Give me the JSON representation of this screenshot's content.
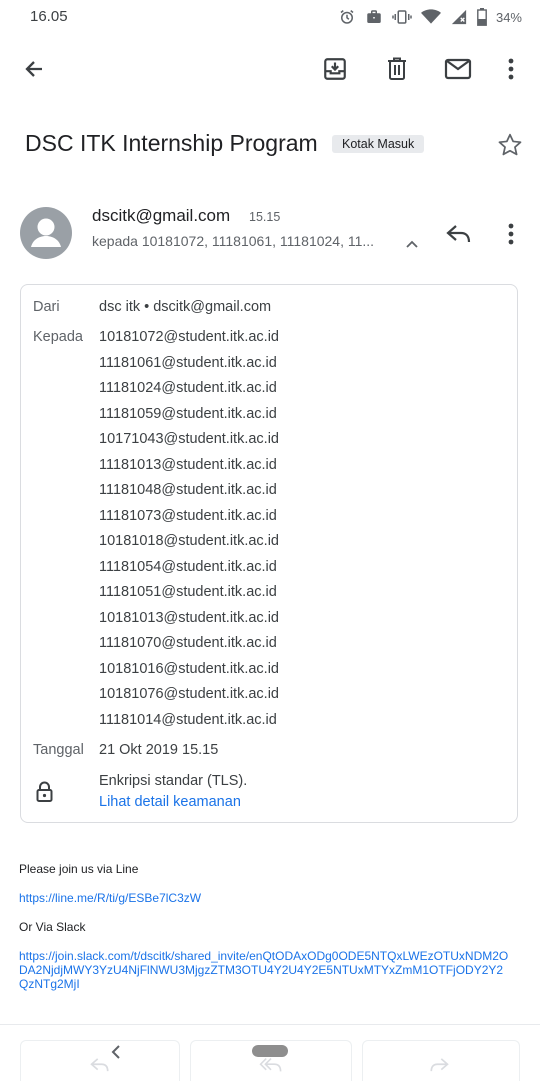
{
  "status_bar": {
    "time": "16.05",
    "battery": "34%"
  },
  "app_bar": {
    "back_icon": "arrow-left-icon",
    "actions": [
      "archive-icon",
      "trash-icon",
      "mail-icon",
      "more-vert-icon"
    ]
  },
  "subject": {
    "title": "DSC ITK Internship Program",
    "label": "Kotak Masuk"
  },
  "sender": {
    "email": "dscitk@gmail.com",
    "time": "15.15",
    "recipients_summary": "kepada 10181072, 11181061, 11181024, 11..."
  },
  "details": {
    "from_label": "Dari",
    "from_value": "dsc itk • dscitk@gmail.com",
    "to_label": "Kepada",
    "to_list": [
      "10181072@student.itk.ac.id",
      "11181061@student.itk.ac.id",
      "11181024@student.itk.ac.id",
      "11181059@student.itk.ac.id",
      "10171043@student.itk.ac.id",
      "11181013@student.itk.ac.id",
      "11181048@student.itk.ac.id",
      "11181073@student.itk.ac.id",
      "10181018@student.itk.ac.id",
      "11181054@student.itk.ac.id",
      "11181051@student.itk.ac.id",
      "10181013@student.itk.ac.id",
      "11181070@student.itk.ac.id",
      "10181016@student.itk.ac.id",
      "10181076@student.itk.ac.id",
      "11181014@student.itk.ac.id"
    ],
    "date_label": "Tanggal",
    "date_value": "21 Okt 2019 15.15",
    "encryption": "Enkripsi standar (TLS).",
    "security_link": "Lihat detail keamanan"
  },
  "message": {
    "line1": "Please join us via Line",
    "line_url": "https://line.me/R/ti/g/ESBe7lC3zW",
    "line2": "Or Via Slack",
    "slack_url": "https://join.slack.com/t/dscitk/shared_invite/enQtODAxODg0ODE5NTQxLWEzOTUxNDM2ODA2NjdjMWY3YzU4NjFlNWU3MjgzZTM3OTU4Y2U4Y2E5NTUxMTYxZmM1OTFjODY2Y2QzNTg2MjI"
  }
}
